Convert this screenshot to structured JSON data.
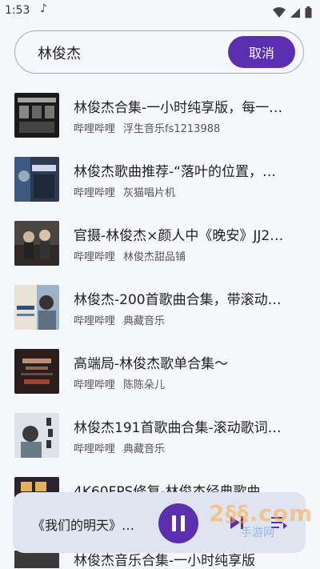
{
  "status": {
    "time": "1:53"
  },
  "search": {
    "query": "林俊杰",
    "cancel_label": "取消"
  },
  "results": [
    {
      "title": "林俊杰合集-一小时纯享版，每一…",
      "source": "哔哩哔哩",
      "uploader": "浮生音乐fs1213988"
    },
    {
      "title": "林俊杰歌曲推荐-“落叶的位置，…",
      "source": "哔哩哔哩",
      "uploader": "灰猫唱片机"
    },
    {
      "title": "官摄-林俊杰×颜人中《晚安》JJ2…",
      "source": "哔哩哔哩",
      "uploader": "林俊杰甜品铺"
    },
    {
      "title": " 林俊杰-200首歌曲合集，带滚动…",
      "source": "哔哩哔哩",
      "uploader": "典藏音乐"
    },
    {
      "title": "高端局-林俊杰歌单合集～",
      "source": "哔哩哔哩",
      "uploader": "陈陈朵儿"
    },
    {
      "title": "林俊杰191首歌曲合集-滚动歌词…",
      "source": "哔哩哔哩",
      "uploader": "典藏音乐"
    },
    {
      "title": "4K60FPS修复-林俊杰经典歌曲…",
      "source": "",
      "uploader": ""
    },
    {
      "title": "林俊杰音乐合集-一小时纯享版",
      "source": "",
      "uploader": ""
    }
  ],
  "player": {
    "track": "《我们的明天》…"
  },
  "watermark": {
    "brand": "2§§.com",
    "sub": "手游网"
  },
  "colors": {
    "accent": "#5b2fb0",
    "player_bg": "#dfe4ef"
  }
}
